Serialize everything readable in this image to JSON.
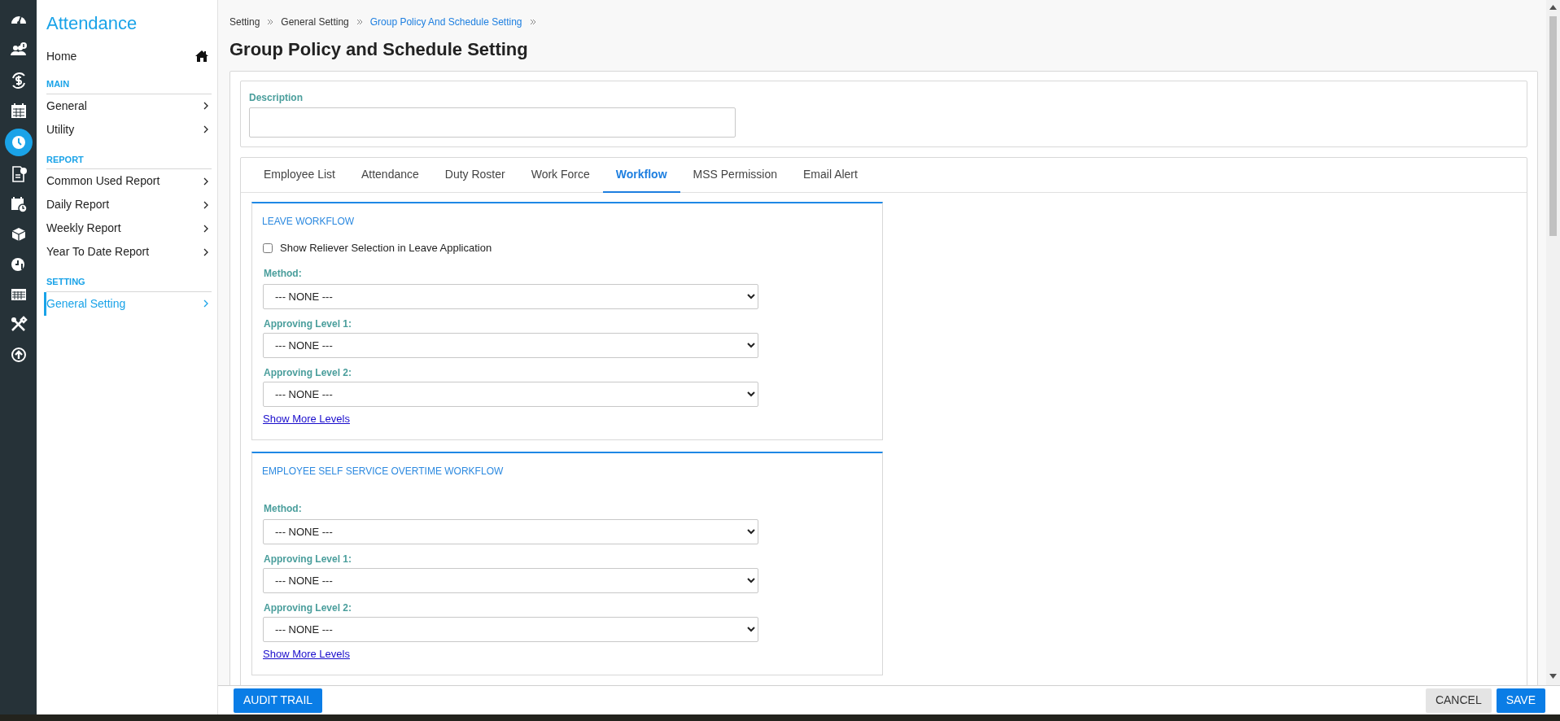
{
  "icon_bar": [
    {
      "kind": "dashboard",
      "selected": false
    },
    {
      "kind": "people",
      "selected": false
    },
    {
      "kind": "dollar",
      "selected": false
    },
    {
      "kind": "calendar",
      "selected": false
    },
    {
      "kind": "clock",
      "selected": true
    },
    {
      "kind": "invoice",
      "selected": false
    },
    {
      "kind": "schedule",
      "selected": false
    },
    {
      "kind": "box",
      "selected": false
    },
    {
      "kind": "clock_info",
      "selected": false
    },
    {
      "kind": "grid",
      "selected": false
    },
    {
      "kind": "tools",
      "selected": false
    },
    {
      "kind": "upload",
      "selected": false
    }
  ],
  "sidebar": {
    "title": "Attendance",
    "home": "Home",
    "sections": [
      {
        "title": "MAIN",
        "items": [
          {
            "label": "General",
            "selected": false
          },
          {
            "label": "Utility",
            "selected": false
          }
        ]
      },
      {
        "title": "REPORT",
        "items": [
          {
            "label": "Common Used Report",
            "selected": false
          },
          {
            "label": "Daily Report",
            "selected": false
          },
          {
            "label": "Weekly Report",
            "selected": false
          },
          {
            "label": "Year To Date Report",
            "selected": false
          }
        ]
      },
      {
        "title": "SETTING",
        "items": [
          {
            "label": "General Setting",
            "selected": true
          }
        ]
      }
    ]
  },
  "breadcrumb": [
    {
      "label": "Setting",
      "current": false
    },
    {
      "label": "General Setting",
      "current": false
    },
    {
      "label": "Group Policy And Schedule Setting",
      "current": true
    }
  ],
  "page_title": "Group Policy and Schedule Setting",
  "description": {
    "label": "Description"
  },
  "tabs": [
    {
      "label": "Employee List",
      "selected": false
    },
    {
      "label": "Attendance",
      "selected": false
    },
    {
      "label": "Duty Roster",
      "selected": false
    },
    {
      "label": "Work Force",
      "selected": false
    },
    {
      "label": "Workflow",
      "selected": true
    },
    {
      "label": "MSS Permission",
      "selected": false
    },
    {
      "label": "Email Alert",
      "selected": false
    }
  ],
  "panels": [
    {
      "title": "LEAVE WORKFLOW",
      "checkbox": {
        "label": "Show Reliever Selection in Leave Application",
        "checked": false
      },
      "fields": [
        {
          "label": "Method:",
          "value": "--- NONE ---"
        },
        {
          "label": "Approving Level 1:",
          "value": "--- NONE ---"
        },
        {
          "label": "Approving Level 2:",
          "value": "--- NONE ---"
        }
      ],
      "link": "Show More Levels"
    },
    {
      "title": "EMPLOYEE SELF SERVICE OVERTIME WORKFLOW",
      "fields": [
        {
          "label": "Method:",
          "value": "--- NONE ---"
        },
        {
          "label": "Approving Level 1:",
          "value": "--- NONE ---"
        },
        {
          "label": "Approving Level 2:",
          "value": "--- NONE ---"
        }
      ],
      "link": "Show More Levels"
    }
  ],
  "footer": {
    "left": [
      {
        "label": "AUDIT TRAIL",
        "kind": "primary"
      }
    ],
    "right": [
      {
        "label": "CANCEL",
        "kind": "secondary"
      },
      {
        "label": "SAVE",
        "kind": "primary"
      }
    ]
  }
}
